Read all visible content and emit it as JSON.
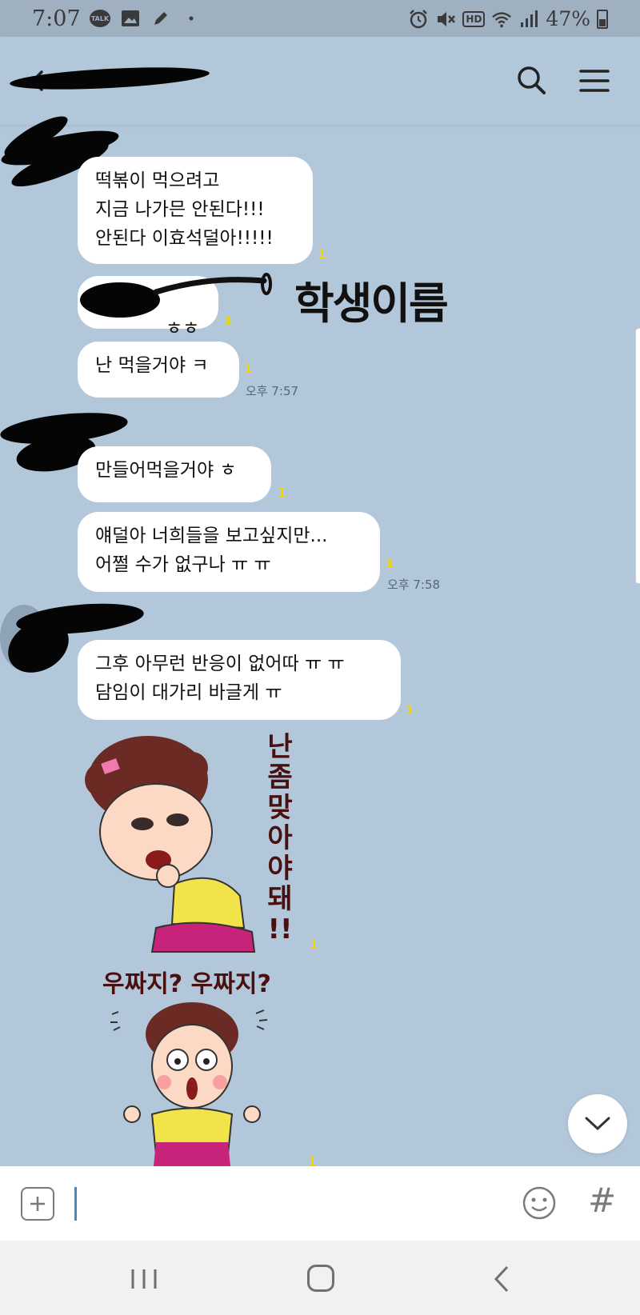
{
  "status_bar": {
    "time": "7:07",
    "talk_label": "TALK",
    "hd_label": "HD",
    "battery_percent": "47%",
    "icons": [
      "kakaotalk-notification-icon",
      "gallery-icon",
      "pen-icon",
      "dot-icon",
      "alarm-icon",
      "mute-icon",
      "hd-voice-icon",
      "wifi-icon",
      "signal-icon",
      "battery-icon"
    ]
  },
  "header": {
    "icons": [
      "back-arrow-icon",
      "search-icon",
      "menu-icon"
    ]
  },
  "messages": [
    {
      "text": "떡볶이 먹으려고\n지금 나가믄 안된다!!!\n안된다 이효석덜아!!!!!",
      "unread": "1",
      "time": ""
    },
    {
      "text": "ㅎㅎ",
      "unread": "1",
      "time": ""
    },
    {
      "text": "난 먹을거야 ㅋ",
      "unread": "1",
      "time": "오후 7:57"
    },
    {
      "text": "만들어먹을거야 ㅎ",
      "unread": "1",
      "time": ""
    },
    {
      "text": "얘덜아 너희들을 보고싶지만...\n어쩔 수가 없구나  ㅠ ㅠ",
      "unread": "1",
      "time": "오후 7:58"
    },
    {
      "text": "그후 아무런 반응이 없어따 ㅠ ㅠ\n담임이 대가리 바글게 ㅠ",
      "unread": "1",
      "time": ""
    }
  ],
  "annotation": "학생이름",
  "stickers": [
    {
      "text": "난\n좀\n맞\n아\n야\n돼\n!!",
      "unread": "1"
    },
    {
      "text": "우짜지? 우짜지?",
      "unread": "1"
    }
  ],
  "input": {
    "placeholder": "",
    "value": "",
    "hash_label": "#"
  },
  "colors": {
    "chat_background": "#b2c7da",
    "status_bar": "#9fb0c1",
    "unread_count": "#f2d600",
    "caret": "#4a87c4"
  }
}
